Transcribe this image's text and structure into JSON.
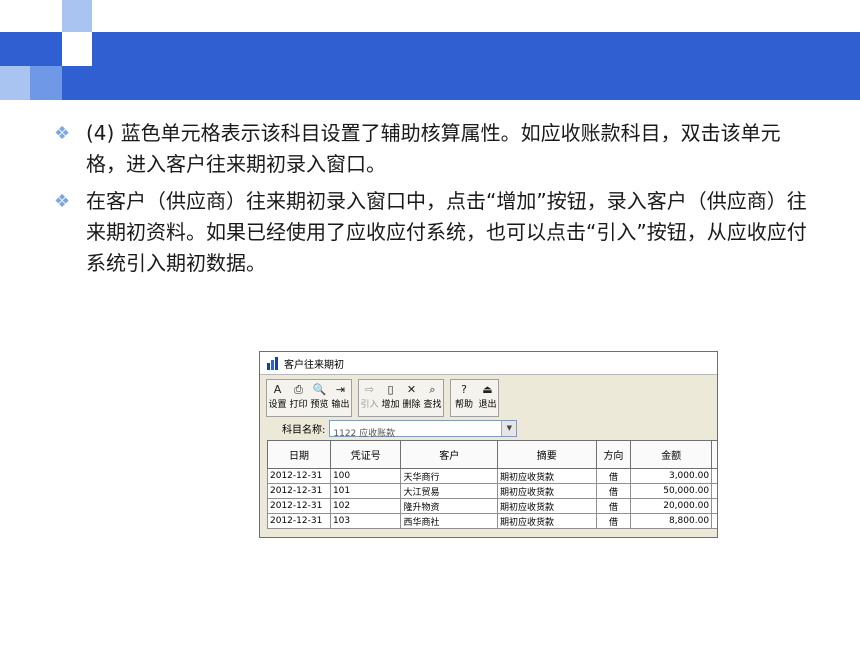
{
  "slide": {
    "bullets": [
      "(4) 蓝色单元格表示该科目设置了辅助核算属性。如应收账款科目，双击该单元格，进入客户往来期初录入窗口。",
      "在客户（供应商）往来期初录入窗口中，点击“增加”按钮，录入客户（供应商）往来期初资料。如果已经使用了应收应付系统，也可以点击“引入”按钮，从应收应付系统引入期初数据。"
    ],
    "colors": {
      "band": "#2f5fd0",
      "deco_light": "#a9c4f1",
      "deco_mid": "#6f98e6",
      "bullet": "#7ea6e0"
    }
  },
  "window": {
    "title": "客户往来期初",
    "toolbar": {
      "group1": [
        {
          "label": "设置",
          "icon": "setup-icon",
          "glyph": "A"
        },
        {
          "label": "打印",
          "icon": "print-icon",
          "glyph": "⎙"
        },
        {
          "label": "预览",
          "icon": "preview-icon",
          "glyph": "🔍"
        },
        {
          "label": "输出",
          "icon": "export-icon",
          "glyph": "⇥"
        }
      ],
      "group2": [
        {
          "label": "引入",
          "icon": "import-icon",
          "glyph": "⇨",
          "disabled": true
        },
        {
          "label": "增加",
          "icon": "add-icon",
          "glyph": "▯"
        },
        {
          "label": "删除",
          "icon": "delete-icon",
          "glyph": "✕"
        },
        {
          "label": "查找",
          "icon": "find-icon",
          "glyph": "⌕"
        }
      ],
      "group3": [
        {
          "label": "帮助",
          "icon": "help-icon",
          "glyph": "?"
        },
        {
          "label": "退出",
          "icon": "exit-icon",
          "glyph": "⏏"
        }
      ]
    },
    "subject": {
      "label": "科目名称:",
      "value": "1122 应收账款"
    },
    "table": {
      "headers": [
        "日期",
        "凭证号",
        "客户",
        "摘要",
        "方向",
        "金额"
      ],
      "rows": [
        [
          "2012-12-31",
          "100",
          "天华商行",
          "期初应收货款",
          "借",
          "3,000.00"
        ],
        [
          "2012-12-31",
          "101",
          "大江贸易",
          "期初应收货款",
          "借",
          "50,000.00"
        ],
        [
          "2012-12-31",
          "102",
          "隆升物资",
          "期初应收货款",
          "借",
          "20,000.00"
        ],
        [
          "2012-12-31",
          "103",
          "西华商社",
          "期初应收货款",
          "借",
          "8,800.00"
        ]
      ]
    }
  }
}
